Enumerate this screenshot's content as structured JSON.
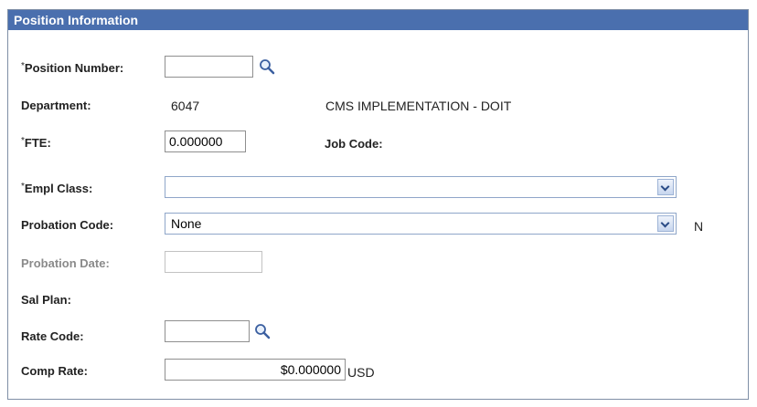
{
  "section": {
    "title": "Position Information"
  },
  "fields": {
    "position_number": {
      "label": "Position Number:",
      "required": "*",
      "value": ""
    },
    "department": {
      "label": "Department:",
      "id": "6047",
      "name": "CMS IMPLEMENTATION - DOIT"
    },
    "fte": {
      "label": "FTE:",
      "required": "*",
      "value": "0.000000"
    },
    "job_code": {
      "label": "Job Code:"
    },
    "empl_class": {
      "label": "Empl Class:",
      "required": "*",
      "selected": ""
    },
    "probation_code": {
      "label": "Probation Code:",
      "selected": "None",
      "indicator": "N"
    },
    "probation_date": {
      "label": "Probation Date:",
      "value": ""
    },
    "sal_plan": {
      "label": "Sal Plan:"
    },
    "rate_code": {
      "label": "Rate Code:",
      "value": ""
    },
    "comp_rate": {
      "label": "Comp Rate:",
      "value": "$0.000000",
      "currency": "USD"
    }
  },
  "icons": {
    "lookup": "magnifier-icon",
    "dropdown": "chevron-down-icon"
  },
  "colors": {
    "header_bg": "#4a6fae",
    "header_text": "#ffffff",
    "disabled_label": "#8a8a8a"
  }
}
